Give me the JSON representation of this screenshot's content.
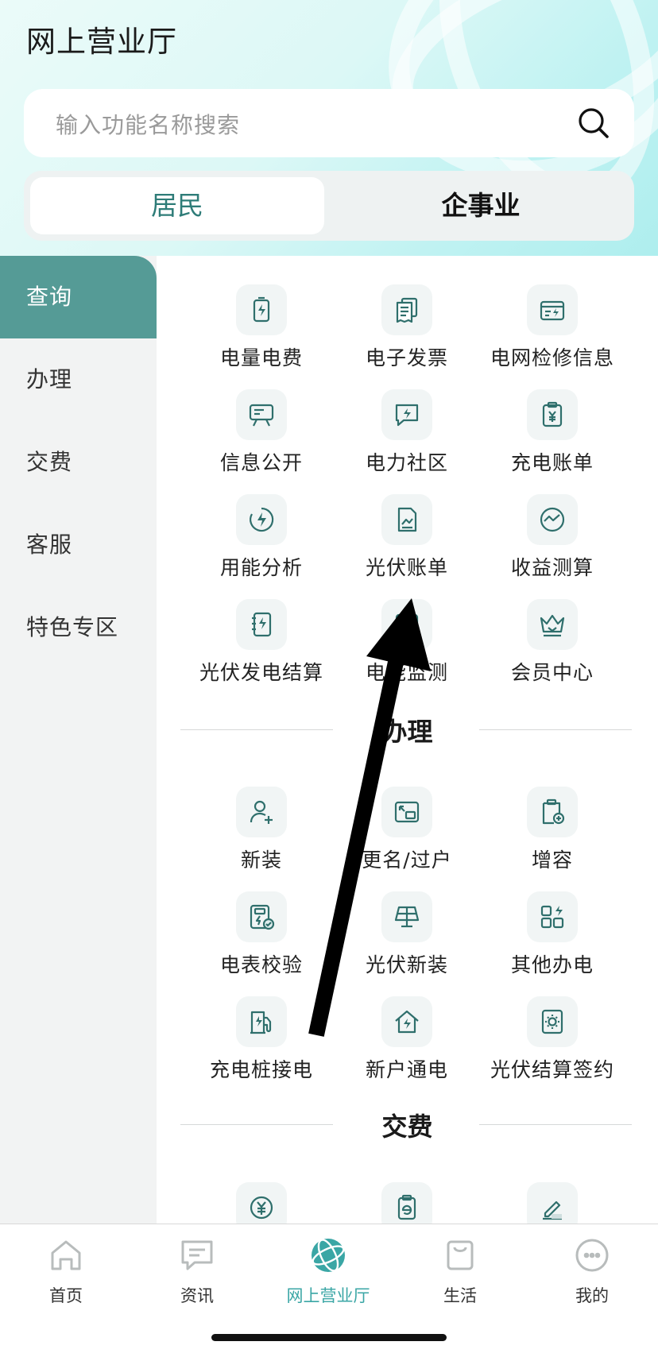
{
  "header": {
    "title": "网上营业厅"
  },
  "search": {
    "placeholder": "输入功能名称搜索"
  },
  "segment": {
    "tabs": [
      "居民",
      "企事业"
    ],
    "active": 0
  },
  "sidebar": {
    "items": [
      "查询",
      "办理",
      "交费",
      "客服",
      "特色专区"
    ],
    "active": 0
  },
  "query_items": [
    {
      "label": "电量电费",
      "icon": "battery-bolt-icon"
    },
    {
      "label": "电子发票",
      "icon": "invoice-icon"
    },
    {
      "label": "电网检修信息",
      "icon": "grid-maintenance-icon"
    },
    {
      "label": "信息公开",
      "icon": "billboard-icon"
    },
    {
      "label": "电力社区",
      "icon": "chat-bolt-icon"
    },
    {
      "label": "充电账单",
      "icon": "clipboard-yen-icon"
    },
    {
      "label": "用能分析",
      "icon": "energy-gauge-icon"
    },
    {
      "label": "光伏账单",
      "icon": "pv-bill-icon"
    },
    {
      "label": "收益测算",
      "icon": "earnings-icon"
    },
    {
      "label": "光伏发电结算",
      "icon": "notebook-bolt-icon"
    },
    {
      "label": "电能监测",
      "icon": "monitor-icon"
    },
    {
      "label": "会员中心",
      "icon": "crown-icon"
    }
  ],
  "sections": {
    "handle": "办理",
    "pay": "交费"
  },
  "handle_items": [
    {
      "label": "新装",
      "icon": "user-plus-icon"
    },
    {
      "label": "更名/过户",
      "icon": "transfer-icon"
    },
    {
      "label": "增容",
      "icon": "clipboard-plus-icon"
    },
    {
      "label": "电表校验",
      "icon": "meter-check-icon"
    },
    {
      "label": "光伏新装",
      "icon": "solar-panel-icon"
    },
    {
      "label": "其他办电",
      "icon": "apps-bolt-icon"
    },
    {
      "label": "充电桩接电",
      "icon": "charging-pile-icon"
    },
    {
      "label": "新户通电",
      "icon": "house-bolt-icon"
    },
    {
      "label": "光伏结算签约",
      "icon": "sun-contract-icon"
    }
  ],
  "pay_items": [
    {
      "icon": "yen-coin-icon"
    },
    {
      "icon": "e-card-icon"
    },
    {
      "icon": "pen-sign-icon"
    }
  ],
  "bottom_nav": {
    "items": [
      {
        "label": "首页",
        "icon": "home-icon"
      },
      {
        "label": "资讯",
        "icon": "message-icon"
      },
      {
        "label": "网上营业厅",
        "icon": "globe-icon"
      },
      {
        "label": "生活",
        "icon": "shopping-bag-icon"
      },
      {
        "label": "我的",
        "icon": "face-icon"
      }
    ],
    "active": 2
  },
  "colors": {
    "accent": "#559b96",
    "accent_text": "#2e7c78",
    "nav_active": "#3aa6a5",
    "icon_stroke": "#2f6f6c"
  }
}
